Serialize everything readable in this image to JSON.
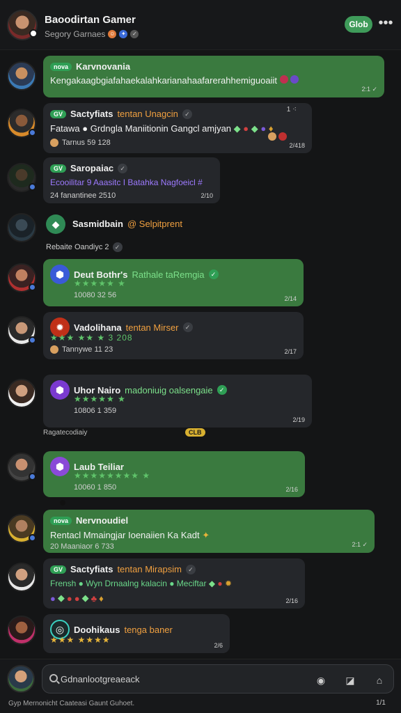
{
  "header": {
    "title": "Baoodirtan Gamer",
    "subtitle": "Segory Garnaes",
    "action_button": "Glob",
    "menu_glyph": "•••"
  },
  "messages": [
    {
      "tag": "nova",
      "name": "Karvnovania",
      "body": "Kengakaagbgiafahaekalahkarianahaafarerahhemiguoaiit",
      "time": "2:1 ✓"
    },
    {
      "tag": "GV",
      "name": "Sactyfiats",
      "highlight": "tentan Unagcin",
      "body": "Fatawa ● Grdngla Maniitionin Gangcl amjyan",
      "meta": "Tarnus 59 128",
      "time": "2/418",
      "corner": "1 ⁖"
    },
    {
      "tag": "GV",
      "name": "Saropaiac",
      "body": "Ecooilitar 9 Aaasitc I Batahka Nagfoeicl #",
      "meta": "24 fanantinee 2510",
      "time": "2/10"
    },
    {
      "name": "Sasmidbain",
      "highlight": "@ Selpitprent",
      "meta": "Rebaite Oandiyc 2"
    },
    {
      "name": "Deut Bothr's",
      "highlight": "Rathale taRemgia",
      "stars": "★★★★★ ★",
      "meta": "10080 32 56",
      "time": "2/14"
    },
    {
      "name": "Vadolihana",
      "highlight": "tentan Mirser",
      "stars": "★★★ ★★ ★ 3 208",
      "meta": "Tannywe 11 23",
      "time": "2/17"
    },
    {
      "name": "Uhor Nairo",
      "highlight": "madoniuig oalsengaie",
      "stars": "★★★★★ ★",
      "meta": "10806 1 359",
      "time": "2/19"
    },
    {
      "note": "Ragatecodiaiy",
      "note_badge": "CLB"
    },
    {
      "name": "Laub Teiliar",
      "stars": "★★★★★★★★ ★",
      "meta": "10060 1 850",
      "time": "2/16"
    },
    {
      "tag": "nova",
      "name": "Nervnoudiel",
      "body": "Rentacl Mmaingjar Ioenaiien Ka Kadt",
      "meta": "20 Maaniaor 6 733",
      "time": "2:1 ✓"
    },
    {
      "tag": "GV",
      "name": "Sactyfiats",
      "highlight": "tentan Mirapsim",
      "body": "Frensh ● Wyn Drnaalng kalacin ● Meciftar",
      "time": "2/16"
    },
    {
      "name": "Doohikaus",
      "highlight": "tenga baner",
      "stars": "★★★ ★★★★",
      "time": "2/6"
    }
  ],
  "composer": {
    "placeholder": "Gdnanlootgreaeack",
    "footer_left": "Gyp Mernonicht Caateasi Gaunt Guhoet.",
    "footer_right": "1/1"
  },
  "icons": {
    "camera": "camera-icon",
    "sticker": "sticker-icon",
    "send": "send-icon",
    "search": "search-icon"
  },
  "colors": {
    "accent_green": "#3f9b5a",
    "bubble_green": "#3a7a3f",
    "bubble_dark": "#25272b",
    "highlight_orange": "#f0a040"
  }
}
